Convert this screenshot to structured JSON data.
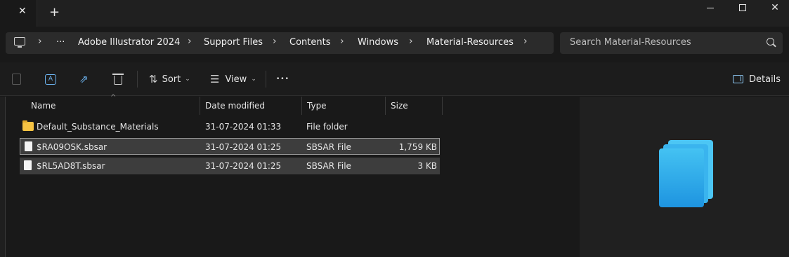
{
  "titlebar": {
    "tab_close_glyph": "✕",
    "new_tab_glyph": "+",
    "close_glyph": "✕"
  },
  "address": {
    "overflow": "···",
    "crumbs": [
      "Adobe Illustrator 2024",
      "Support Files",
      "Contents",
      "Windows",
      "Material-Resources"
    ],
    "chevron": "›"
  },
  "search": {
    "placeholder": "Search Material-Resources"
  },
  "commandbar": {
    "sort_label": "Sort",
    "view_label": "View",
    "more_glyph": "•••",
    "details_label": "Details",
    "dropdown_glyph": "⌄"
  },
  "columns": {
    "name": "Name",
    "date": "Date modified",
    "type": "Type",
    "size": "Size"
  },
  "files": [
    {
      "name": "Default_Substance_Materials",
      "date": "31-07-2024 01:33",
      "type": "File folder",
      "size": "",
      "kind": "folder"
    },
    {
      "name": "$RA09OSK.sbsar",
      "date": "31-07-2024 01:25",
      "type": "SBSAR File",
      "size": "1,759 KB",
      "kind": "file"
    },
    {
      "name": "$RL5AD8T.sbsar",
      "date": "31-07-2024 01:25",
      "type": "SBSAR File",
      "size": "3 KB",
      "kind": "file"
    }
  ],
  "colors": {
    "accent": "#6cb4f0",
    "folder": "#f6c343",
    "preview_stack": [
      "#2aa3e6",
      "#3ab4ee",
      "#4cc6f4"
    ]
  }
}
